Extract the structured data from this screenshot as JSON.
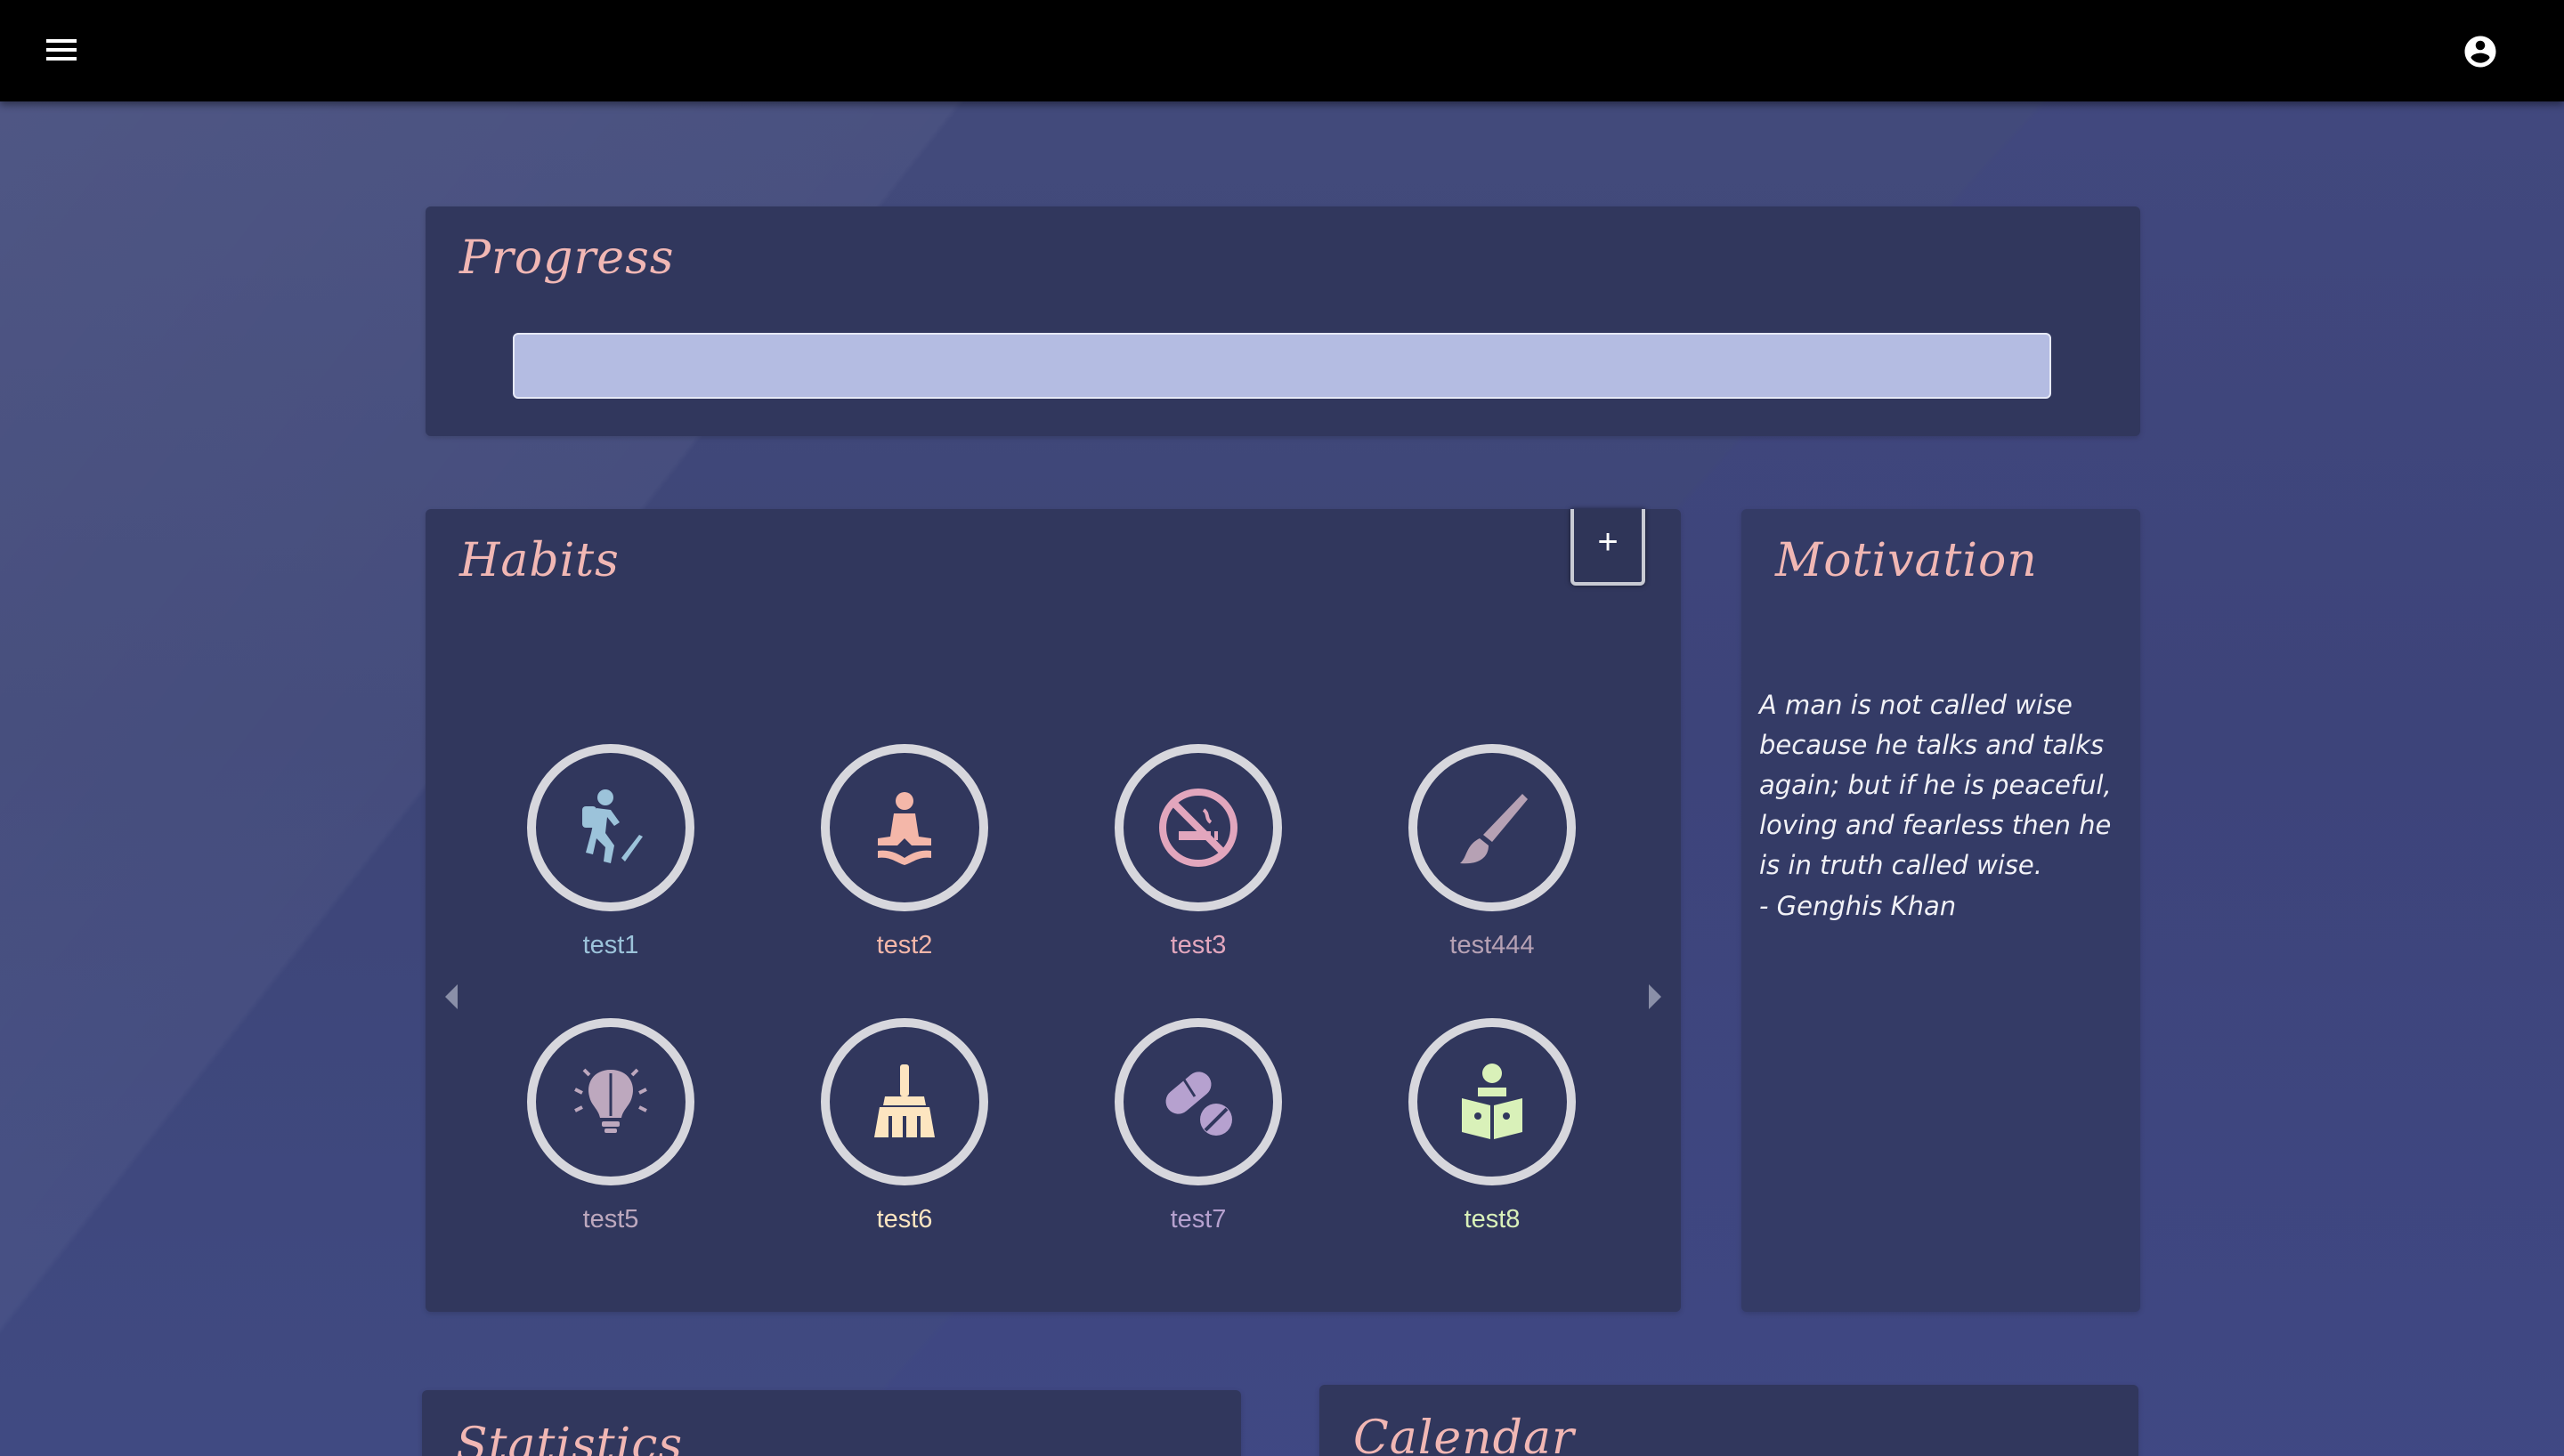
{
  "header": {
    "menu_icon": "menu-icon",
    "account_icon": "account-circle-icon"
  },
  "progress": {
    "title": "Progress",
    "value_percent": 0
  },
  "habits": {
    "title": "Habits",
    "add_label": "+",
    "items": [
      {
        "label": "test1",
        "icon": "hiking-icon",
        "color": "#9cc3da"
      },
      {
        "label": "test2",
        "icon": "meditation-icon",
        "color": "#f4b7a9"
      },
      {
        "label": "test3",
        "icon": "no-smoking-icon",
        "color": "#e2a6bd"
      },
      {
        "label": "test444",
        "icon": "paintbrush-icon",
        "color": "#b6a1b4"
      },
      {
        "label": "test5",
        "icon": "brain-bulb-icon",
        "color": "#bda8be"
      },
      {
        "label": "test6",
        "icon": "broom-icon",
        "color": "#fde5c0"
      },
      {
        "label": "test7",
        "icon": "pills-icon",
        "color": "#b6a1cf"
      },
      {
        "label": "test8",
        "icon": "reading-icon",
        "color": "#d9f1b9"
      }
    ]
  },
  "motivation": {
    "title": "Motivation",
    "quote": "A man is not called wise because he talks and talks again; but if he is peaceful, loving and fearless then he is in truth called wise.",
    "author": "- Genghis Khan"
  },
  "statistics": {
    "title": "Statistics"
  },
  "calendar": {
    "title": "Calendar"
  }
}
